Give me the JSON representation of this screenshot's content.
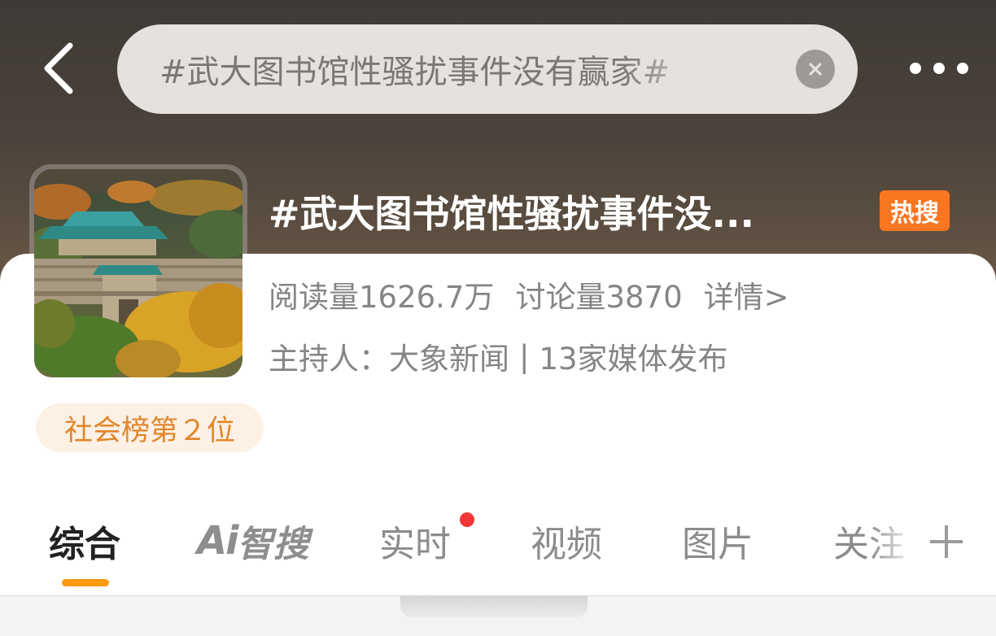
{
  "header": {
    "search_query": "#武大图书馆性骚扰事件没有赢家#",
    "icons": {
      "back": "chevron-left-icon",
      "clear": "close-circle-icon",
      "more": "more-horizontal-icon"
    }
  },
  "topic": {
    "title": "#武大图书馆性骚扰事件没...",
    "hot_badge": "热搜",
    "read_count": "阅读量1626.7万",
    "discussion_count": "讨论量3870",
    "details_link": "详情>",
    "host": "主持人：大象新闻",
    "media_count": "13家媒体发布",
    "separator": "|",
    "rank": "社会榜第２位"
  },
  "tabs": [
    {
      "label": "综合",
      "active": true
    },
    {
      "label": "Ai智搜",
      "ai_part": "Ai",
      "text_part": "智搜",
      "active": false
    },
    {
      "label": "实时",
      "active": false,
      "has_red_dot": true
    },
    {
      "label": "视频",
      "active": false
    },
    {
      "label": "图片",
      "active": false
    },
    {
      "label": "关注",
      "active": false
    }
  ],
  "colors": {
    "hot_badge": "#fa7620",
    "rank_text": "#e2862a",
    "rank_bg": "#fdf1e6",
    "tab_underline": "#ff9a0e",
    "red_dot": "#f0383a"
  }
}
